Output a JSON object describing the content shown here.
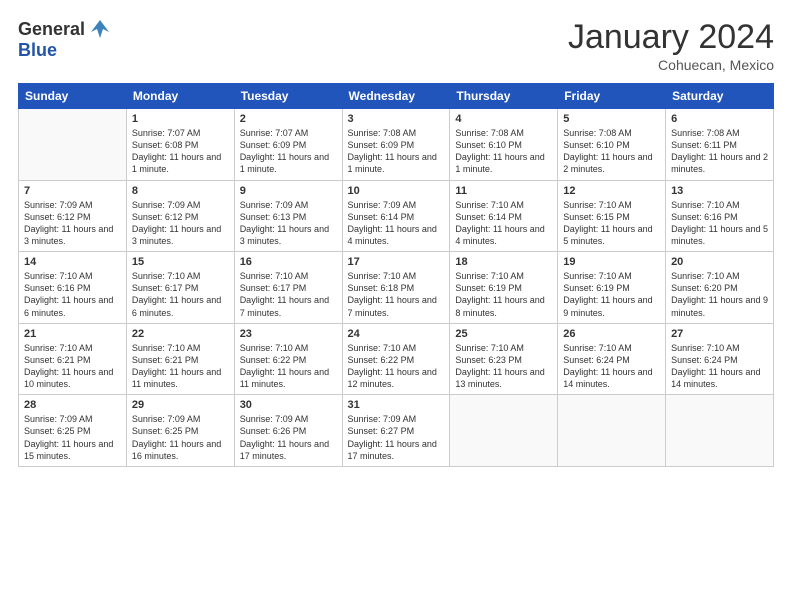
{
  "header": {
    "logo_general": "General",
    "logo_blue": "Blue",
    "title": "January 2024",
    "location": "Cohuecan, Mexico"
  },
  "days_of_week": [
    "Sunday",
    "Monday",
    "Tuesday",
    "Wednesday",
    "Thursday",
    "Friday",
    "Saturday"
  ],
  "weeks": [
    [
      {
        "num": "",
        "sunrise": "",
        "sunset": "",
        "daylight": "",
        "empty": true
      },
      {
        "num": "1",
        "sunrise": "Sunrise: 7:07 AM",
        "sunset": "Sunset: 6:08 PM",
        "daylight": "Daylight: 11 hours and 1 minute."
      },
      {
        "num": "2",
        "sunrise": "Sunrise: 7:07 AM",
        "sunset": "Sunset: 6:09 PM",
        "daylight": "Daylight: 11 hours and 1 minute."
      },
      {
        "num": "3",
        "sunrise": "Sunrise: 7:08 AM",
        "sunset": "Sunset: 6:09 PM",
        "daylight": "Daylight: 11 hours and 1 minute."
      },
      {
        "num": "4",
        "sunrise": "Sunrise: 7:08 AM",
        "sunset": "Sunset: 6:10 PM",
        "daylight": "Daylight: 11 hours and 1 minute."
      },
      {
        "num": "5",
        "sunrise": "Sunrise: 7:08 AM",
        "sunset": "Sunset: 6:10 PM",
        "daylight": "Daylight: 11 hours and 2 minutes."
      },
      {
        "num": "6",
        "sunrise": "Sunrise: 7:08 AM",
        "sunset": "Sunset: 6:11 PM",
        "daylight": "Daylight: 11 hours and 2 minutes."
      }
    ],
    [
      {
        "num": "7",
        "sunrise": "Sunrise: 7:09 AM",
        "sunset": "Sunset: 6:12 PM",
        "daylight": "Daylight: 11 hours and 3 minutes."
      },
      {
        "num": "8",
        "sunrise": "Sunrise: 7:09 AM",
        "sunset": "Sunset: 6:12 PM",
        "daylight": "Daylight: 11 hours and 3 minutes."
      },
      {
        "num": "9",
        "sunrise": "Sunrise: 7:09 AM",
        "sunset": "Sunset: 6:13 PM",
        "daylight": "Daylight: 11 hours and 3 minutes."
      },
      {
        "num": "10",
        "sunrise": "Sunrise: 7:09 AM",
        "sunset": "Sunset: 6:14 PM",
        "daylight": "Daylight: 11 hours and 4 minutes."
      },
      {
        "num": "11",
        "sunrise": "Sunrise: 7:10 AM",
        "sunset": "Sunset: 6:14 PM",
        "daylight": "Daylight: 11 hours and 4 minutes."
      },
      {
        "num": "12",
        "sunrise": "Sunrise: 7:10 AM",
        "sunset": "Sunset: 6:15 PM",
        "daylight": "Daylight: 11 hours and 5 minutes."
      },
      {
        "num": "13",
        "sunrise": "Sunrise: 7:10 AM",
        "sunset": "Sunset: 6:16 PM",
        "daylight": "Daylight: 11 hours and 5 minutes."
      }
    ],
    [
      {
        "num": "14",
        "sunrise": "Sunrise: 7:10 AM",
        "sunset": "Sunset: 6:16 PM",
        "daylight": "Daylight: 11 hours and 6 minutes."
      },
      {
        "num": "15",
        "sunrise": "Sunrise: 7:10 AM",
        "sunset": "Sunset: 6:17 PM",
        "daylight": "Daylight: 11 hours and 6 minutes."
      },
      {
        "num": "16",
        "sunrise": "Sunrise: 7:10 AM",
        "sunset": "Sunset: 6:17 PM",
        "daylight": "Daylight: 11 hours and 7 minutes."
      },
      {
        "num": "17",
        "sunrise": "Sunrise: 7:10 AM",
        "sunset": "Sunset: 6:18 PM",
        "daylight": "Daylight: 11 hours and 7 minutes."
      },
      {
        "num": "18",
        "sunrise": "Sunrise: 7:10 AM",
        "sunset": "Sunset: 6:19 PM",
        "daylight": "Daylight: 11 hours and 8 minutes."
      },
      {
        "num": "19",
        "sunrise": "Sunrise: 7:10 AM",
        "sunset": "Sunset: 6:19 PM",
        "daylight": "Daylight: 11 hours and 9 minutes."
      },
      {
        "num": "20",
        "sunrise": "Sunrise: 7:10 AM",
        "sunset": "Sunset: 6:20 PM",
        "daylight": "Daylight: 11 hours and 9 minutes."
      }
    ],
    [
      {
        "num": "21",
        "sunrise": "Sunrise: 7:10 AM",
        "sunset": "Sunset: 6:21 PM",
        "daylight": "Daylight: 11 hours and 10 minutes."
      },
      {
        "num": "22",
        "sunrise": "Sunrise: 7:10 AM",
        "sunset": "Sunset: 6:21 PM",
        "daylight": "Daylight: 11 hours and 11 minutes."
      },
      {
        "num": "23",
        "sunrise": "Sunrise: 7:10 AM",
        "sunset": "Sunset: 6:22 PM",
        "daylight": "Daylight: 11 hours and 11 minutes."
      },
      {
        "num": "24",
        "sunrise": "Sunrise: 7:10 AM",
        "sunset": "Sunset: 6:22 PM",
        "daylight": "Daylight: 11 hours and 12 minutes."
      },
      {
        "num": "25",
        "sunrise": "Sunrise: 7:10 AM",
        "sunset": "Sunset: 6:23 PM",
        "daylight": "Daylight: 11 hours and 13 minutes."
      },
      {
        "num": "26",
        "sunrise": "Sunrise: 7:10 AM",
        "sunset": "Sunset: 6:24 PM",
        "daylight": "Daylight: 11 hours and 14 minutes."
      },
      {
        "num": "27",
        "sunrise": "Sunrise: 7:10 AM",
        "sunset": "Sunset: 6:24 PM",
        "daylight": "Daylight: 11 hours and 14 minutes."
      }
    ],
    [
      {
        "num": "28",
        "sunrise": "Sunrise: 7:09 AM",
        "sunset": "Sunset: 6:25 PM",
        "daylight": "Daylight: 11 hours and 15 minutes."
      },
      {
        "num": "29",
        "sunrise": "Sunrise: 7:09 AM",
        "sunset": "Sunset: 6:25 PM",
        "daylight": "Daylight: 11 hours and 16 minutes."
      },
      {
        "num": "30",
        "sunrise": "Sunrise: 7:09 AM",
        "sunset": "Sunset: 6:26 PM",
        "daylight": "Daylight: 11 hours and 17 minutes."
      },
      {
        "num": "31",
        "sunrise": "Sunrise: 7:09 AM",
        "sunset": "Sunset: 6:27 PM",
        "daylight": "Daylight: 11 hours and 17 minutes."
      },
      {
        "num": "",
        "sunrise": "",
        "sunset": "",
        "daylight": "",
        "empty": true
      },
      {
        "num": "",
        "sunrise": "",
        "sunset": "",
        "daylight": "",
        "empty": true
      },
      {
        "num": "",
        "sunrise": "",
        "sunset": "",
        "daylight": "",
        "empty": true
      }
    ]
  ]
}
